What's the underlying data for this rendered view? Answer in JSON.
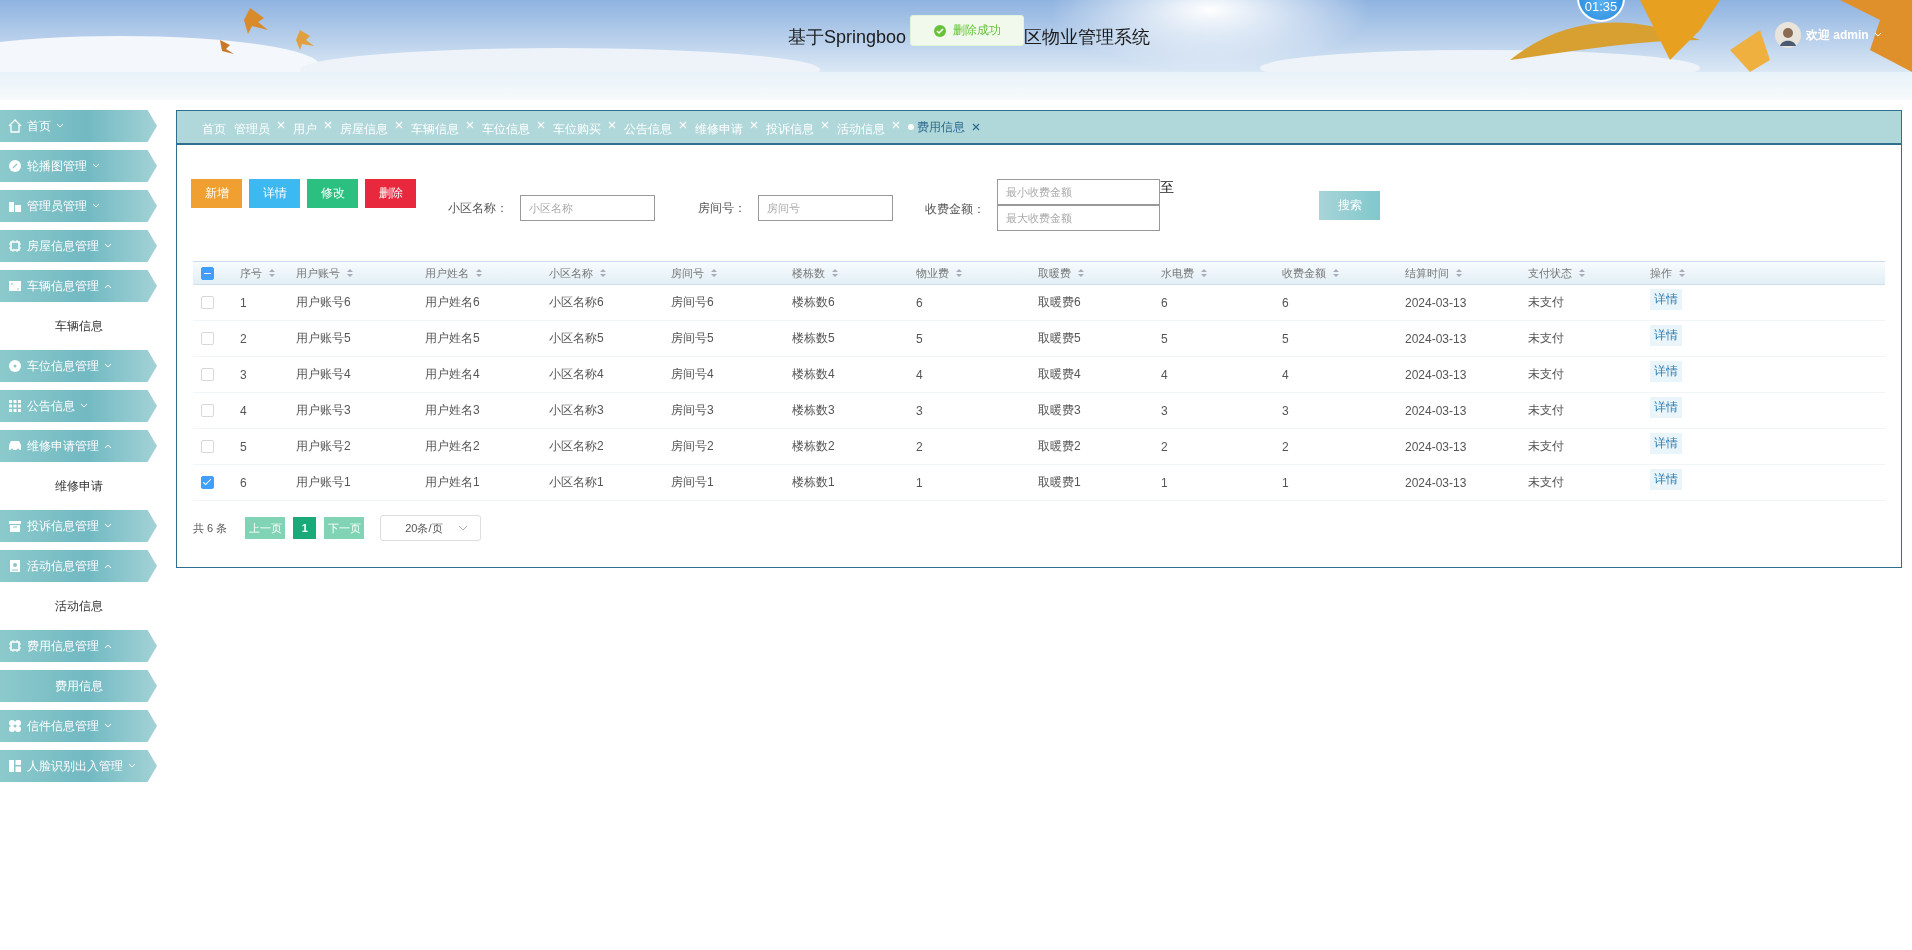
{
  "header": {
    "title_parts": [
      "基于Springboo",
      "区物业管理系统"
    ],
    "clock": "01:35",
    "user": "欢迎 admin"
  },
  "toast": {
    "message": "删除成功"
  },
  "sidebar": {
    "items": [
      {
        "label": "首页",
        "expanded": false
      },
      {
        "label": "轮播图管理",
        "expanded": false
      },
      {
        "label": "管理员管理",
        "expanded": false
      },
      {
        "label": "房屋信息管理",
        "expanded": false
      },
      {
        "label": "车辆信息管理",
        "expanded": true,
        "children": [
          {
            "label": "车辆信息",
            "selected": false
          }
        ]
      },
      {
        "label": "车位信息管理",
        "expanded": false
      },
      {
        "label": "公告信息",
        "expanded": false
      },
      {
        "label": "维修申请管理",
        "expanded": true,
        "children": [
          {
            "label": "维修申请",
            "selected": false
          }
        ]
      },
      {
        "label": "投诉信息管理",
        "expanded": false
      },
      {
        "label": "活动信息管理",
        "expanded": true,
        "children": [
          {
            "label": "活动信息",
            "selected": false
          }
        ]
      },
      {
        "label": "费用信息管理",
        "expanded": true,
        "children": [
          {
            "label": "费用信息",
            "selected": true
          }
        ]
      },
      {
        "label": "信件信息管理",
        "expanded": false
      },
      {
        "label": "人脸识别出入管理",
        "expanded": false
      }
    ]
  },
  "tabs": [
    {
      "label": "首页",
      "closable": false,
      "selected": false
    },
    {
      "label": "管理员",
      "closable": true,
      "selected": false
    },
    {
      "label": "用户",
      "closable": true,
      "selected": false
    },
    {
      "label": "房屋信息",
      "closable": true,
      "selected": false
    },
    {
      "label": "车辆信息",
      "closable": true,
      "selected": false
    },
    {
      "label": "车位信息",
      "closable": true,
      "selected": false
    },
    {
      "label": "车位购买",
      "closable": true,
      "selected": false
    },
    {
      "label": "公告信息",
      "closable": true,
      "selected": false
    },
    {
      "label": "维修申请",
      "closable": true,
      "selected": false
    },
    {
      "label": "投诉信息",
      "closable": true,
      "selected": false
    },
    {
      "label": "活动信息",
      "closable": true,
      "selected": false
    },
    {
      "label": "费用信息",
      "closable": true,
      "selected": true
    }
  ],
  "toolbar": {
    "buttons": [
      {
        "label": "新增",
        "color": "#f0a030"
      },
      {
        "label": "详情",
        "color": "#3db8f0"
      },
      {
        "label": "修改",
        "color": "#2cc080"
      },
      {
        "label": "删除",
        "color": "#e8283c"
      }
    ],
    "filters": {
      "community": {
        "label": "小区名称：",
        "placeholder": "小区名称"
      },
      "room": {
        "label": "房间号：",
        "placeholder": "房间号"
      },
      "amount": {
        "label": "收费金额：",
        "min_placeholder": "最小收费金额",
        "max_placeholder": "最大收费金额",
        "separator": "至"
      }
    },
    "search": "搜索"
  },
  "table": {
    "header_checkbox": {
      "indeterminate": true
    },
    "columns": [
      "序号",
      "用户账号",
      "用户姓名",
      "小区名称",
      "房间号",
      "楼栋数",
      "物业费",
      "取暖费",
      "水电费",
      "收费金额",
      "结算时间",
      "支付状态",
      "操作"
    ],
    "rows": [
      {
        "checked": false,
        "cells": [
          "1",
          "用户账号6",
          "用户姓名6",
          "小区名称6",
          "房间号6",
          "楼栋数6",
          "6",
          "取暖费6",
          "6",
          "6",
          "2024-03-13",
          "未支付"
        ],
        "action": "详情"
      },
      {
        "checked": false,
        "cells": [
          "2",
          "用户账号5",
          "用户姓名5",
          "小区名称5",
          "房间号5",
          "楼栋数5",
          "5",
          "取暖费5",
          "5",
          "5",
          "2024-03-13",
          "未支付"
        ],
        "action": "详情"
      },
      {
        "checked": false,
        "cells": [
          "3",
          "用户账号4",
          "用户姓名4",
          "小区名称4",
          "房间号4",
          "楼栋数4",
          "4",
          "取暖费4",
          "4",
          "4",
          "2024-03-13",
          "未支付"
        ],
        "action": "详情"
      },
      {
        "checked": false,
        "cells": [
          "4",
          "用户账号3",
          "用户姓名3",
          "小区名称3",
          "房间号3",
          "楼栋数3",
          "3",
          "取暖费3",
          "3",
          "3",
          "2024-03-13",
          "未支付"
        ],
        "action": "详情"
      },
      {
        "checked": false,
        "cells": [
          "5",
          "用户账号2",
          "用户姓名2",
          "小区名称2",
          "房间号2",
          "楼栋数2",
          "2",
          "取暖费2",
          "2",
          "2",
          "2024-03-13",
          "未支付"
        ],
        "action": "详情"
      },
      {
        "checked": true,
        "cells": [
          "6",
          "用户账号1",
          "用户姓名1",
          "小区名称1",
          "房间号1",
          "楼栋数1",
          "1",
          "取暖费1",
          "1",
          "1",
          "2024-03-13",
          "未支付"
        ],
        "action": "详情"
      }
    ]
  },
  "pagination": {
    "total": "共 6 条",
    "prev": "上一页",
    "pages": [
      {
        "label": "1",
        "selected": true
      }
    ],
    "next": "下一页",
    "page_size": "20条/页"
  }
}
